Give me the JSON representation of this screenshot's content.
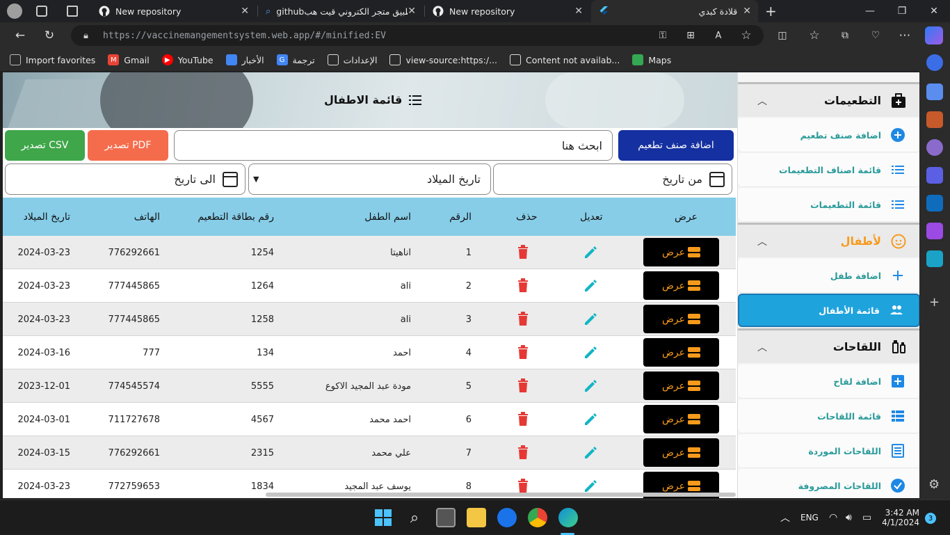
{
  "browser": {
    "tabs": [
      {
        "title": "New repository",
        "icon": "github-icon"
      },
      {
        "title": "githubطبيق متجر الكتروني قيت هب",
        "icon": "search-icon"
      },
      {
        "title": "New repository",
        "icon": "github-icon"
      },
      {
        "title": "قلادة كبدي",
        "icon": "flutter-icon",
        "active": true
      }
    ],
    "url": "https://vaccinemangementsystem.web.app/#/minified:EV",
    "favorites": [
      {
        "label": "Import favorites",
        "icon": "import-icon"
      },
      {
        "label": "Gmail",
        "icon": "gmail-icon"
      },
      {
        "label": "YouTube",
        "icon": "youtube-icon"
      },
      {
        "label": "الأخبار",
        "icon": "news-icon"
      },
      {
        "label": "ترجمة",
        "icon": "translate-icon"
      },
      {
        "label": "الإعدادات",
        "icon": "page-icon"
      },
      {
        "label": "view-source:https:/...",
        "icon": "page-icon"
      },
      {
        "label": "Content not availab...",
        "icon": "page-icon"
      },
      {
        "label": "Maps",
        "icon": "maps-icon"
      }
    ]
  },
  "app": {
    "page_title": "قائمة الاطفال",
    "buttons": {
      "add_vaccine_type": "اضافة صنف تطعيم",
      "export_pdf": "تصدير PDF",
      "export_csv": "تصدير CSV"
    },
    "search_placeholder": "ابحث هنا",
    "filters": {
      "from_date": "من تاريخ",
      "birth_date": "تاريخ الميلاد",
      "to_date": "الى تاريخ"
    },
    "table": {
      "headers": {
        "view": "عرض",
        "edit": "تعديل",
        "delete": "حذف",
        "number": "الرقم",
        "child_name": "اسم الطفل",
        "card_number": "رقم بطاقة التطعيم",
        "phone": "الهاتف",
        "birth_date": "تاريخ الميلاد"
      },
      "view_label": "عرض",
      "rows": [
        {
          "number": "1",
          "name": "اناهيتا",
          "card": "1254",
          "phone": "776292661",
          "birth": "2024-03-23"
        },
        {
          "number": "2",
          "name": "ali",
          "card": "1264",
          "phone": "777445865",
          "birth": "2024-03-23"
        },
        {
          "number": "3",
          "name": "ali",
          "card": "1258",
          "phone": "777445865",
          "birth": "2024-03-23"
        },
        {
          "number": "4",
          "name": "احمد",
          "card": "134",
          "phone": "777",
          "birth": "2024-03-16"
        },
        {
          "number": "5",
          "name": "مودة عبد المجيد الاكوع",
          "card": "5555",
          "phone": "774545574",
          "birth": "2023-12-01"
        },
        {
          "number": "6",
          "name": "احمد محمد",
          "card": "4567",
          "phone": "711727678",
          "birth": "2024-03-01"
        },
        {
          "number": "7",
          "name": "علي محمد",
          "card": "2315",
          "phone": "776292661",
          "birth": "2024-03-15"
        },
        {
          "number": "8",
          "name": "يوسف عبد المجيد",
          "card": "1834",
          "phone": "772759653",
          "birth": "2024-03-23"
        }
      ]
    },
    "sidebar": {
      "sections": [
        {
          "label": "التطعيمات",
          "icon": "medical-kit-icon",
          "items": [
            {
              "label": "اضافة صنف تطعيم",
              "icon": "add-circle-icon"
            },
            {
              "label": "قائمة اصناف التطعيمات",
              "icon": "list-icon"
            },
            {
              "label": "قائمة التطعيمات",
              "icon": "list-icon"
            }
          ]
        },
        {
          "label": "لأطفال",
          "icon": "child-face-icon",
          "items": [
            {
              "label": "اضافة طفل",
              "icon": "plus-icon"
            },
            {
              "label": "قائمة الأطفال",
              "icon": "people-icon",
              "active": true
            }
          ]
        },
        {
          "label": "اللقاحات",
          "icon": "vaccine-icon",
          "items": [
            {
              "label": "اضافة لقاح",
              "icon": "add-box-icon"
            },
            {
              "label": "قائمة اللقاحات",
              "icon": "grid-list-icon"
            },
            {
              "label": "اللقاحات الموردة",
              "icon": "document-icon"
            },
            {
              "label": "اللقاحات المصروفة",
              "icon": "check-circle-icon"
            }
          ]
        }
      ]
    },
    "colors": {
      "header_bg": "#87cde8",
      "add_btn": "#1530a0",
      "pdf_btn": "#f56c4c",
      "csv_btn": "#3fa64a",
      "edit_icon": "#12b5c4",
      "delete_icon": "#e53935",
      "view_text": "#f79a1c",
      "sidebar_active": "#1fa3dd",
      "children_section": "#f79a1c"
    }
  },
  "taskbar": {
    "language": "ENG",
    "time": "3:42 AM",
    "date": "4/1/2024",
    "notifications": "3"
  }
}
